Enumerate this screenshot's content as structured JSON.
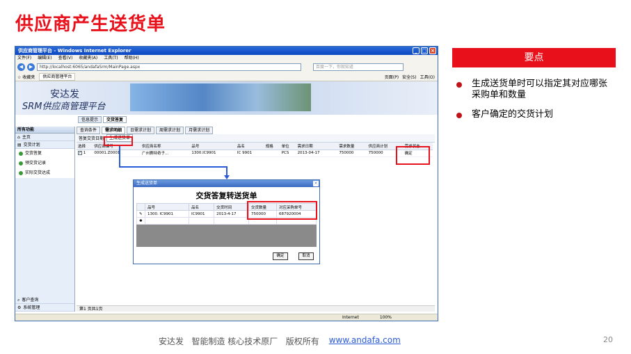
{
  "slide": {
    "title": "供应商产生送货单",
    "page_number": "20",
    "key_header": "要点",
    "key_points": [
      "生成送货单时可以指定其对应哪张采购单和数量",
      "客户确定的交货计划"
    ],
    "footer_text": "安达发   智能制造 核心技术原厂   版权所有",
    "footer_link": "www.andafa.com",
    "accent_color": "#e8101a"
  },
  "browser": {
    "title": "供应商管理平台 - Windows Internet Explorer",
    "menu": [
      "文件(F)",
      "编辑(E)",
      "查看(V)",
      "收藏夹(A)",
      "工具(T)",
      "帮助(H)"
    ],
    "address": "http://localhost:6065/andafaSrm/MainPage.aspx",
    "search_placeholder": "百度一下，你就知道",
    "favorites_label": "收藏夹",
    "fav_tab": "供应商管理平台",
    "tools": [
      "页面(P)",
      "安全(S)",
      "工具(O)"
    ],
    "status_zone": "Internet",
    "zoom": "100%"
  },
  "app": {
    "brand_line1": "安达发",
    "brand_line2": "SRM供应商管理平台",
    "info_tabs": [
      "信息提示",
      "交货答复"
    ],
    "sidebar_header": "所有功能",
    "sidebar_items": [
      "主页",
      "交货计划"
    ],
    "sidebar_subitems": [
      "交货答复",
      "预交货记录",
      "实际交货达成"
    ],
    "sidebar_bottom": [
      "客户查询",
      "系统管理"
    ],
    "sub_tabs": [
      "查询条件",
      "需求明细",
      "日需求计划",
      "周需求计划",
      "月需求计划"
    ],
    "toolbar": [
      "答复交货日期",
      "生成送货单"
    ],
    "columns": [
      "选择",
      "供应商编号",
      "供应商名称",
      "品号",
      "品名",
      "规格",
      "单位",
      "需求日期",
      "需求数量",
      "供应商计划",
      "需求状态"
    ],
    "rows": [
      {
        "check": "✓",
        "no": "1",
        "supplier_code": "00001.Z0001",
        "supplier_name": "广州赛特奇子…",
        "item_no": "1300.IC9901",
        "item_name": "IC 9901",
        "spec": "",
        "unit": "PCS",
        "date": "2013-04-17",
        "qty": "750000",
        "plan": "750000",
        "status": "确定"
      }
    ],
    "pager": "第1    页共1页"
  },
  "dialog": {
    "title": "生成送货单",
    "heading": "交货答复转送货单",
    "columns": [
      "品号",
      "品名",
      "交货时间",
      "交货数量",
      "对应采购单号"
    ],
    "rows": [
      {
        "item_no": "1300. IC9901",
        "item_name": "IC9901",
        "time": "2013-4-17",
        "qty": "750000",
        "po": "687920004"
      }
    ],
    "ok": "确定",
    "cancel": "取消"
  }
}
